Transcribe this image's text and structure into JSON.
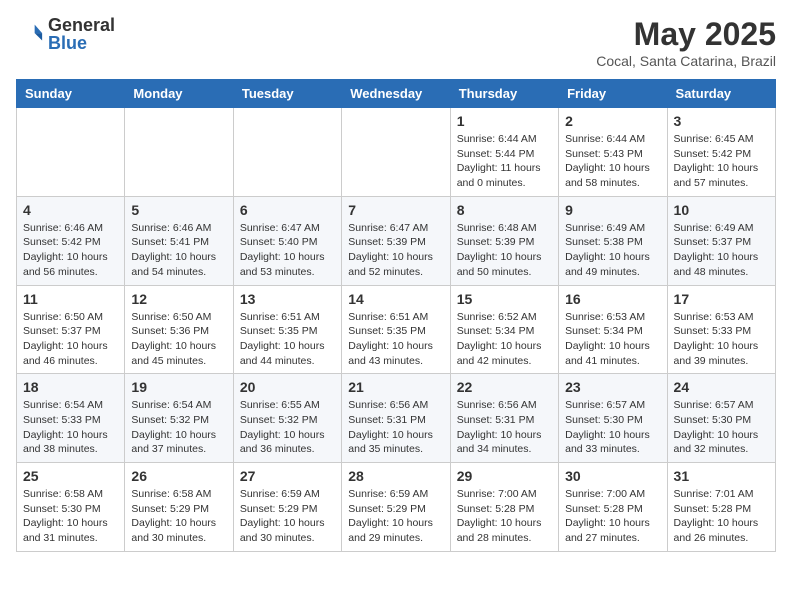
{
  "header": {
    "logo_general": "General",
    "logo_blue": "Blue",
    "month_year": "May 2025",
    "location": "Cocal, Santa Catarina, Brazil"
  },
  "days_of_week": [
    "Sunday",
    "Monday",
    "Tuesday",
    "Wednesday",
    "Thursday",
    "Friday",
    "Saturday"
  ],
  "weeks": [
    [
      {
        "day": "",
        "info": ""
      },
      {
        "day": "",
        "info": ""
      },
      {
        "day": "",
        "info": ""
      },
      {
        "day": "",
        "info": ""
      },
      {
        "day": "1",
        "info": "Sunrise: 6:44 AM\nSunset: 5:44 PM\nDaylight: 11 hours and 0 minutes."
      },
      {
        "day": "2",
        "info": "Sunrise: 6:44 AM\nSunset: 5:43 PM\nDaylight: 10 hours and 58 minutes."
      },
      {
        "day": "3",
        "info": "Sunrise: 6:45 AM\nSunset: 5:42 PM\nDaylight: 10 hours and 57 minutes."
      }
    ],
    [
      {
        "day": "4",
        "info": "Sunrise: 6:46 AM\nSunset: 5:42 PM\nDaylight: 10 hours and 56 minutes."
      },
      {
        "day": "5",
        "info": "Sunrise: 6:46 AM\nSunset: 5:41 PM\nDaylight: 10 hours and 54 minutes."
      },
      {
        "day": "6",
        "info": "Sunrise: 6:47 AM\nSunset: 5:40 PM\nDaylight: 10 hours and 53 minutes."
      },
      {
        "day": "7",
        "info": "Sunrise: 6:47 AM\nSunset: 5:39 PM\nDaylight: 10 hours and 52 minutes."
      },
      {
        "day": "8",
        "info": "Sunrise: 6:48 AM\nSunset: 5:39 PM\nDaylight: 10 hours and 50 minutes."
      },
      {
        "day": "9",
        "info": "Sunrise: 6:49 AM\nSunset: 5:38 PM\nDaylight: 10 hours and 49 minutes."
      },
      {
        "day": "10",
        "info": "Sunrise: 6:49 AM\nSunset: 5:37 PM\nDaylight: 10 hours and 48 minutes."
      }
    ],
    [
      {
        "day": "11",
        "info": "Sunrise: 6:50 AM\nSunset: 5:37 PM\nDaylight: 10 hours and 46 minutes."
      },
      {
        "day": "12",
        "info": "Sunrise: 6:50 AM\nSunset: 5:36 PM\nDaylight: 10 hours and 45 minutes."
      },
      {
        "day": "13",
        "info": "Sunrise: 6:51 AM\nSunset: 5:35 PM\nDaylight: 10 hours and 44 minutes."
      },
      {
        "day": "14",
        "info": "Sunrise: 6:51 AM\nSunset: 5:35 PM\nDaylight: 10 hours and 43 minutes."
      },
      {
        "day": "15",
        "info": "Sunrise: 6:52 AM\nSunset: 5:34 PM\nDaylight: 10 hours and 42 minutes."
      },
      {
        "day": "16",
        "info": "Sunrise: 6:53 AM\nSunset: 5:34 PM\nDaylight: 10 hours and 41 minutes."
      },
      {
        "day": "17",
        "info": "Sunrise: 6:53 AM\nSunset: 5:33 PM\nDaylight: 10 hours and 39 minutes."
      }
    ],
    [
      {
        "day": "18",
        "info": "Sunrise: 6:54 AM\nSunset: 5:33 PM\nDaylight: 10 hours and 38 minutes."
      },
      {
        "day": "19",
        "info": "Sunrise: 6:54 AM\nSunset: 5:32 PM\nDaylight: 10 hours and 37 minutes."
      },
      {
        "day": "20",
        "info": "Sunrise: 6:55 AM\nSunset: 5:32 PM\nDaylight: 10 hours and 36 minutes."
      },
      {
        "day": "21",
        "info": "Sunrise: 6:56 AM\nSunset: 5:31 PM\nDaylight: 10 hours and 35 minutes."
      },
      {
        "day": "22",
        "info": "Sunrise: 6:56 AM\nSunset: 5:31 PM\nDaylight: 10 hours and 34 minutes."
      },
      {
        "day": "23",
        "info": "Sunrise: 6:57 AM\nSunset: 5:30 PM\nDaylight: 10 hours and 33 minutes."
      },
      {
        "day": "24",
        "info": "Sunrise: 6:57 AM\nSunset: 5:30 PM\nDaylight: 10 hours and 32 minutes."
      }
    ],
    [
      {
        "day": "25",
        "info": "Sunrise: 6:58 AM\nSunset: 5:30 PM\nDaylight: 10 hours and 31 minutes."
      },
      {
        "day": "26",
        "info": "Sunrise: 6:58 AM\nSunset: 5:29 PM\nDaylight: 10 hours and 30 minutes."
      },
      {
        "day": "27",
        "info": "Sunrise: 6:59 AM\nSunset: 5:29 PM\nDaylight: 10 hours and 30 minutes."
      },
      {
        "day": "28",
        "info": "Sunrise: 6:59 AM\nSunset: 5:29 PM\nDaylight: 10 hours and 29 minutes."
      },
      {
        "day": "29",
        "info": "Sunrise: 7:00 AM\nSunset: 5:28 PM\nDaylight: 10 hours and 28 minutes."
      },
      {
        "day": "30",
        "info": "Sunrise: 7:00 AM\nSunset: 5:28 PM\nDaylight: 10 hours and 27 minutes."
      },
      {
        "day": "31",
        "info": "Sunrise: 7:01 AM\nSunset: 5:28 PM\nDaylight: 10 hours and 26 minutes."
      }
    ]
  ]
}
